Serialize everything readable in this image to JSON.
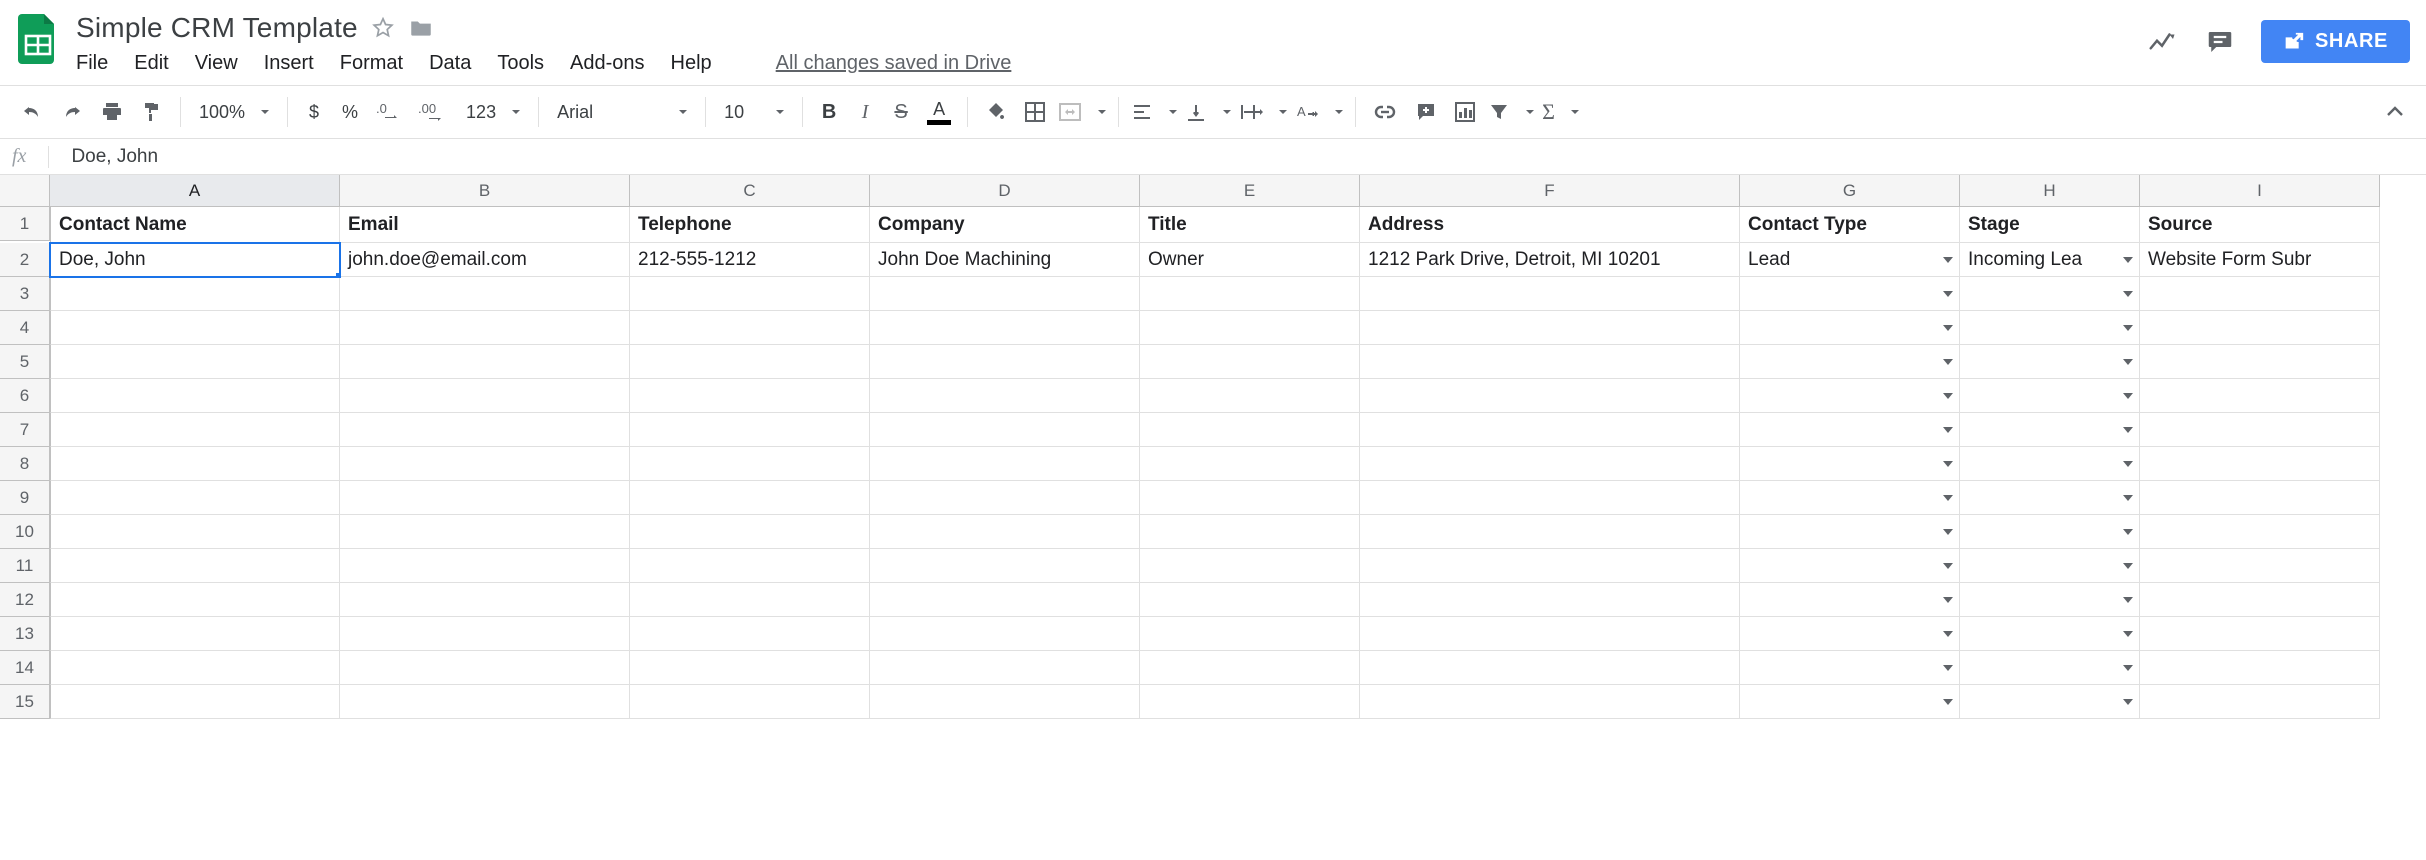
{
  "doc": {
    "title": "Simple CRM Template"
  },
  "menu": {
    "file": "File",
    "edit": "Edit",
    "view": "View",
    "insert": "Insert",
    "format": "Format",
    "data": "Data",
    "tools": "Tools",
    "addons": "Add-ons",
    "help": "Help",
    "save_status": "All changes saved in Drive"
  },
  "share": {
    "label": "SHARE"
  },
  "toolbar": {
    "zoom": "100%",
    "font": "Arial",
    "font_size": "10",
    "more_formats": "123"
  },
  "formula_bar": {
    "fx": "fx",
    "value": "Doe, John"
  },
  "columns": [
    "A",
    "B",
    "C",
    "D",
    "E",
    "F",
    "G",
    "H",
    "I"
  ],
  "row_numbers": [
    "1",
    "2",
    "3",
    "4",
    "5",
    "6",
    "7",
    "8",
    "9",
    "10",
    "11",
    "12",
    "13",
    "14",
    "15"
  ],
  "headers": {
    "A": "Contact Name",
    "B": "Email",
    "C": "Telephone",
    "D": "Company",
    "E": "Title",
    "F": "Address",
    "G": "Contact Type",
    "H": "Stage",
    "I": "Source"
  },
  "rows": [
    {
      "A": "Doe, John",
      "B": "john.doe@email.com",
      "C": "212-555-1212",
      "D": "John Doe Machining",
      "E": "Owner",
      "F": "1212 Park Drive, Detroit, MI 10201",
      "G": "Lead",
      "H": "Incoming Lea",
      "I": "Website Form Subr"
    }
  ],
  "selection": {
    "cell": "A2"
  },
  "dropdown_columns": [
    "G",
    "H"
  ],
  "empty_row_count": 13
}
